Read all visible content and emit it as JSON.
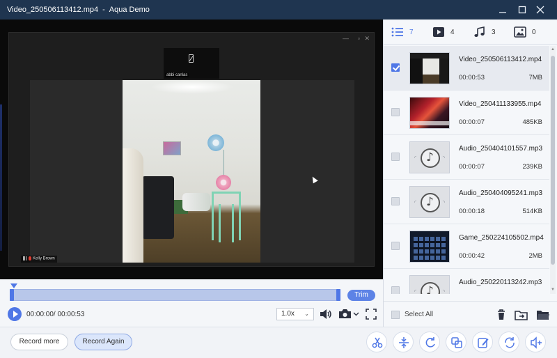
{
  "window": {
    "filename": "Video_250506113412.mp4",
    "separator": "-",
    "app_name": "Aqua Demo"
  },
  "video": {
    "top_participant": "abbi canlas",
    "speaker": "Kelly Brown"
  },
  "controls": {
    "trim_label": "Trim",
    "time_current": "00:00:00/ 00:00:53",
    "speed_value": "1.0x",
    "progress_fraction": 0.0
  },
  "actions": {
    "record_more": "Record more",
    "record_again": "Record Again"
  },
  "tools": [
    "scissors-icon",
    "compress-icon",
    "rotate-icon",
    "merge-icon",
    "edit-icon",
    "convert-icon",
    "volume-boost-icon"
  ],
  "tabs": [
    {
      "icon": "list-icon",
      "count": "7",
      "active": true
    },
    {
      "icon": "video-icon",
      "count": "4",
      "active": false
    },
    {
      "icon": "music-icon",
      "count": "3",
      "active": false
    },
    {
      "icon": "image-icon",
      "count": "0",
      "active": false
    }
  ],
  "files": [
    {
      "name": "Video_250506113412.mp4",
      "duration": "00:00:53",
      "size": "7MB",
      "checked": true,
      "kind": "vid1"
    },
    {
      "name": "Video_250411133955.mp4",
      "duration": "00:00:07",
      "size": "485KB",
      "checked": false,
      "kind": "vid2"
    },
    {
      "name": "Audio_250404101557.mp3",
      "duration": "00:00:07",
      "size": "239KB",
      "checked": false,
      "kind": "audio"
    },
    {
      "name": "Audio_250404095241.mp3",
      "duration": "00:00:18",
      "size": "514KB",
      "checked": false,
      "kind": "audio"
    },
    {
      "name": "Game_250224105502.mp4",
      "duration": "00:00:42",
      "size": "2MB",
      "checked": false,
      "kind": "game"
    },
    {
      "name": "Audio_250220113242.mp3",
      "duration": "",
      "size": "",
      "checked": false,
      "kind": "audio"
    }
  ],
  "panel_footer": {
    "select_all": "Select All"
  },
  "colors": {
    "titlebar": "#1f3550",
    "accent": "#4f77e6",
    "timeline": "#b8c7ea"
  }
}
